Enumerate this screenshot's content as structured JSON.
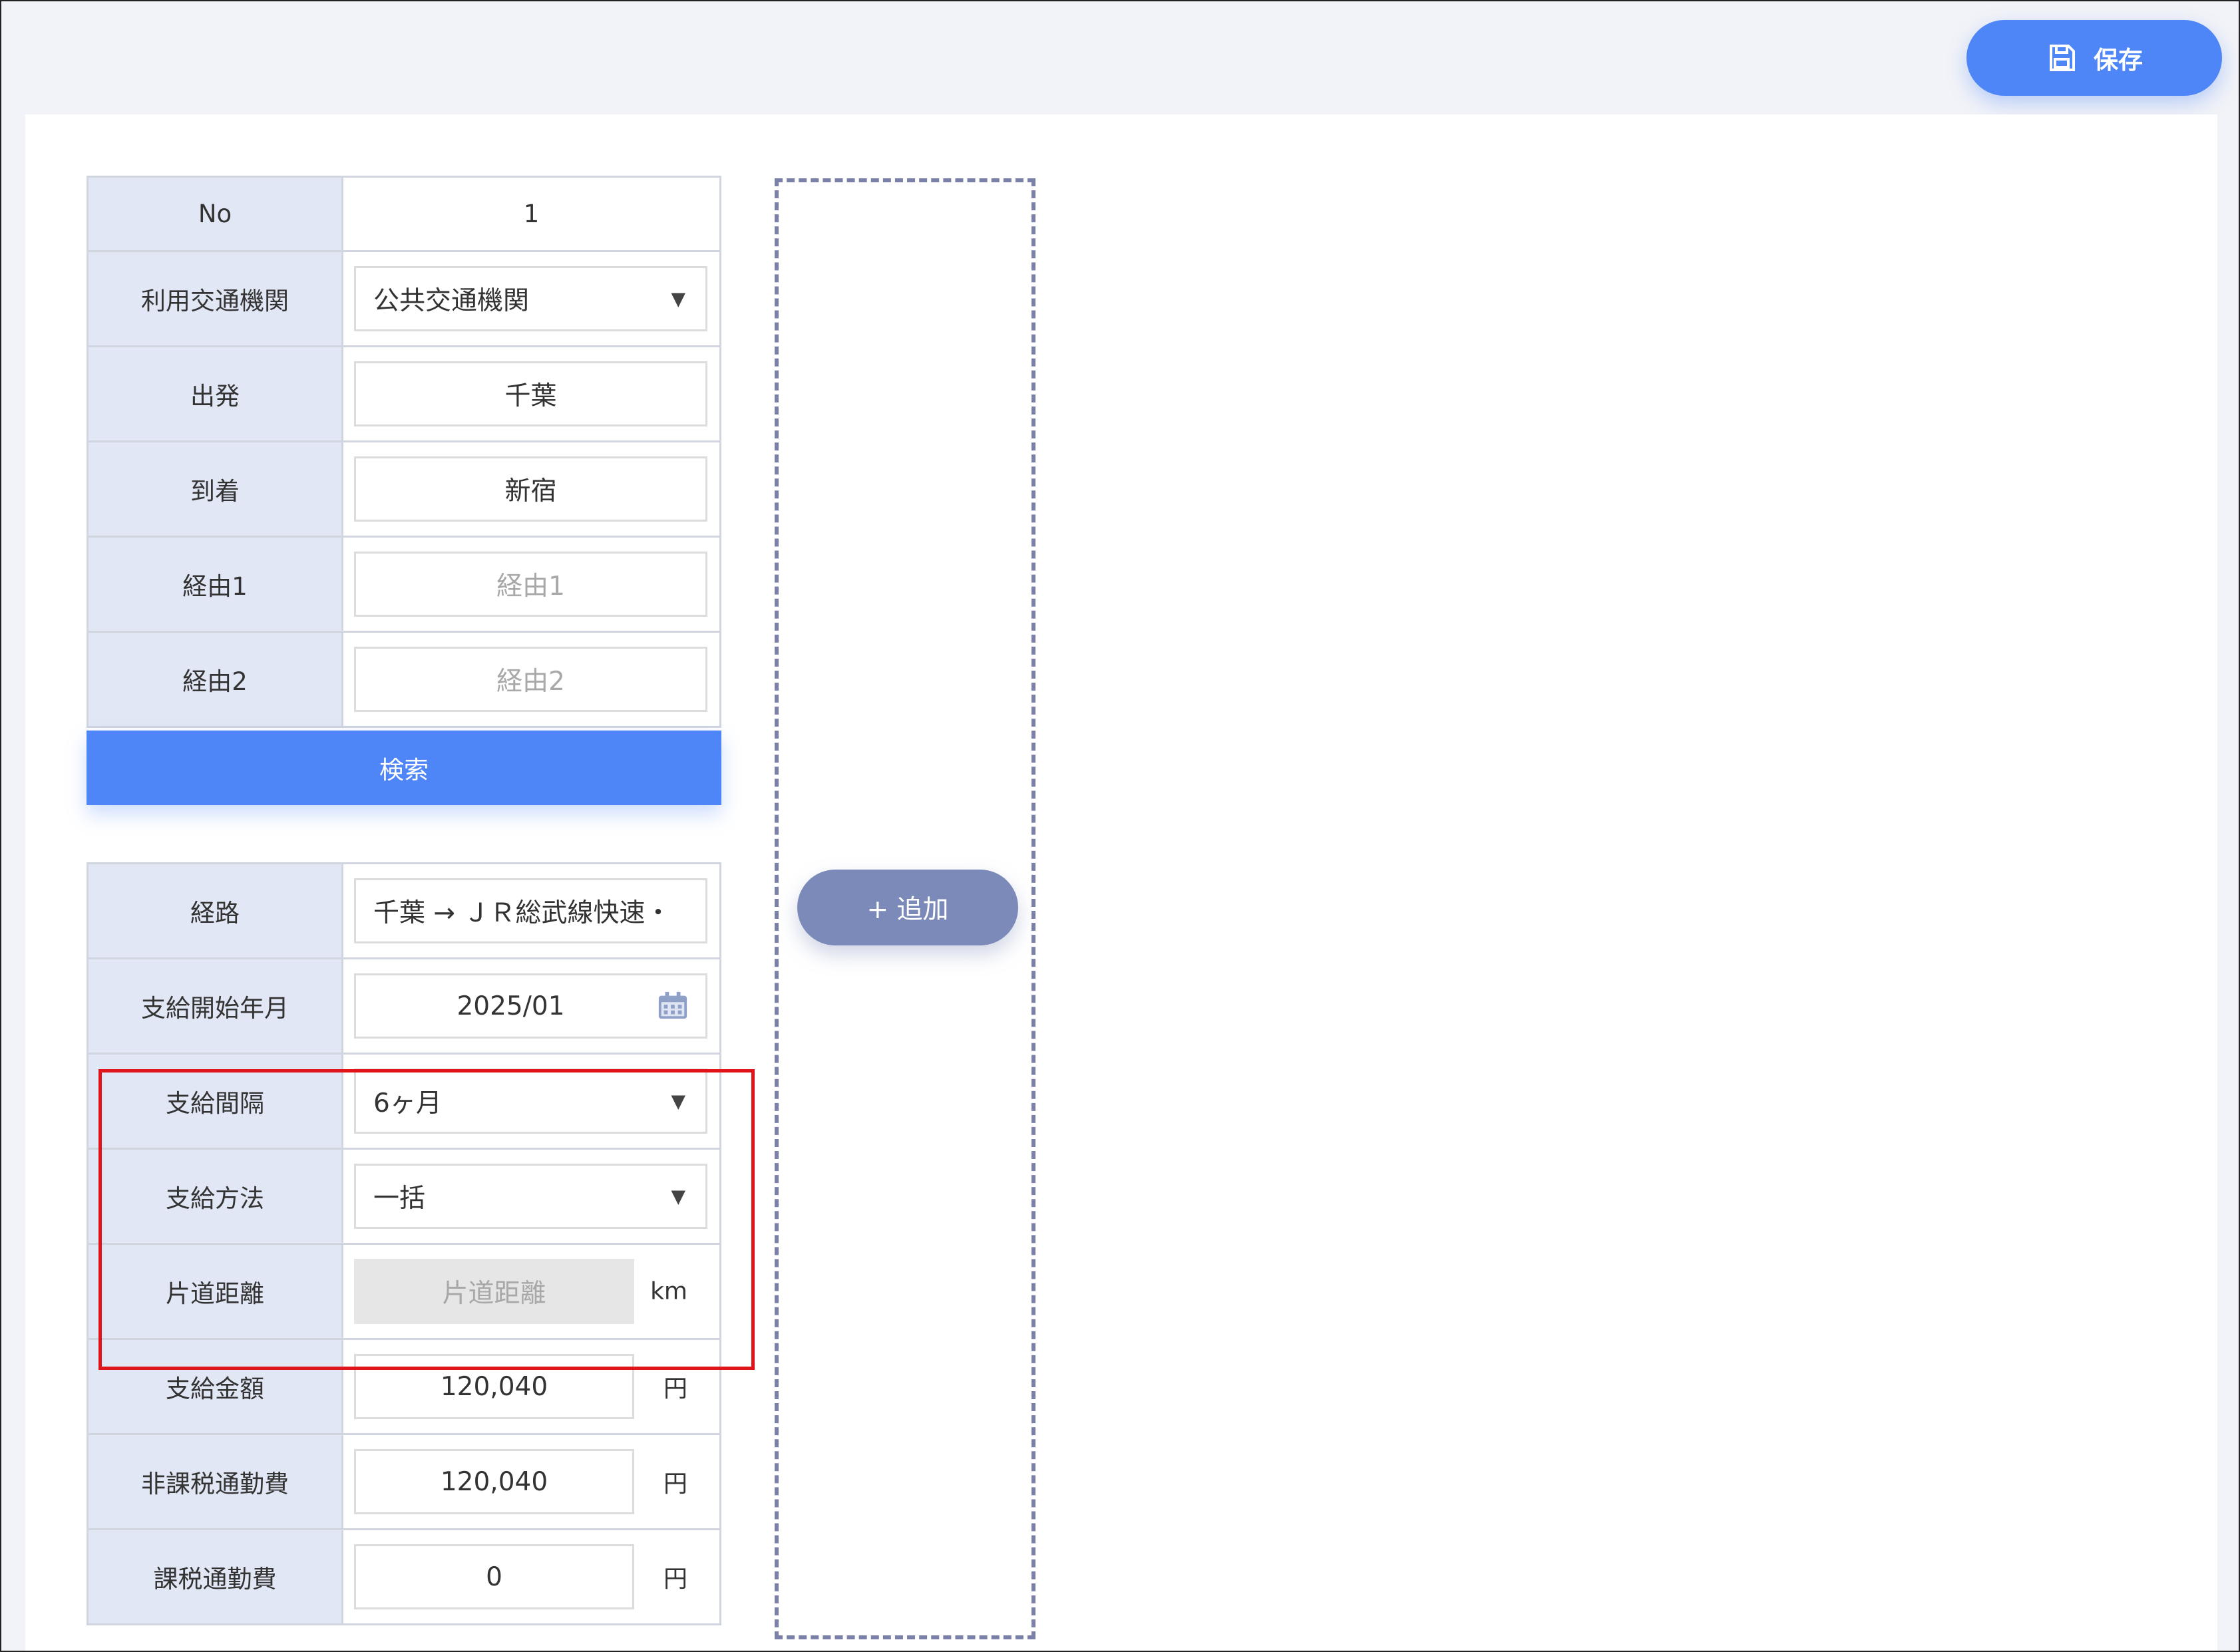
{
  "toolbar": {
    "save_label": "保存"
  },
  "form1": {
    "rows": [
      {
        "label": "No",
        "value": "1"
      },
      {
        "label": "利用交通機関",
        "value": "公共交通機関"
      },
      {
        "label": "出発",
        "value": "千葉"
      },
      {
        "label": "到着",
        "value": "新宿"
      },
      {
        "label": "経由1",
        "placeholder": "経由1"
      },
      {
        "label": "経由2",
        "placeholder": "経由2"
      }
    ],
    "search_label": "検索"
  },
  "form2": {
    "rows": [
      {
        "label": "経路",
        "value": "千葉 → ＪＲ総武線快速・"
      },
      {
        "label": "支給開始年月",
        "value": "2025/01"
      },
      {
        "label": "支給間隔",
        "value": "6ヶ月"
      },
      {
        "label": "支給方法",
        "value": "一括"
      },
      {
        "label": "片道距離",
        "placeholder": "片道距離",
        "unit": "km"
      },
      {
        "label": "支給金額",
        "value": "120,040",
        "unit": "円"
      },
      {
        "label": "非課税通勤費",
        "value": "120,040",
        "unit": "円"
      },
      {
        "label": "課税通勤費",
        "value": "0",
        "unit": "円"
      }
    ]
  },
  "add_label": "+ 追加",
  "colors": {
    "primary": "#4e86f7",
    "secondary": "#7b8ab8",
    "highlight": "#e0151b",
    "label_bg": "#e2e7f5"
  },
  "icons": {
    "save": "floppy-disk-icon",
    "calendar": "calendar-icon",
    "dropdown": "caret-down-icon"
  }
}
